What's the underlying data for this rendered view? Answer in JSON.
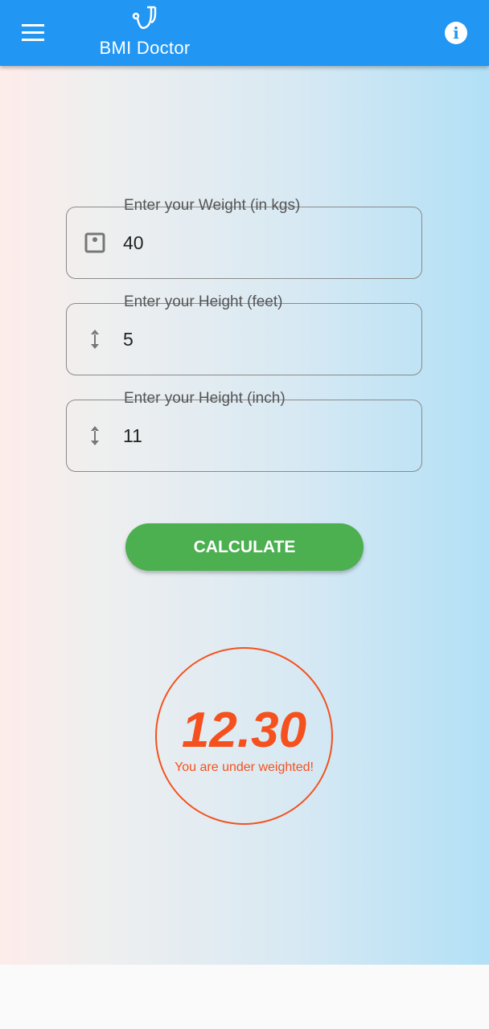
{
  "app": {
    "title": "BMI Doctor"
  },
  "fields": [
    {
      "label": "Enter your Weight (in kgs)",
      "value": "40",
      "icon": "scale-icon"
    },
    {
      "label": "Enter your Height (feet)",
      "value": "5",
      "icon": "height-arrow-icon"
    },
    {
      "label": "Enter your Height (inch)",
      "value": "11",
      "icon": "height-arrow-icon"
    }
  ],
  "calculate_label": "CALCULATE",
  "result": {
    "value": "12.30",
    "message": "You are under weighted!"
  },
  "colors": {
    "appbar": "#2196f3",
    "button": "#4caf50",
    "result": "#f4511e"
  }
}
